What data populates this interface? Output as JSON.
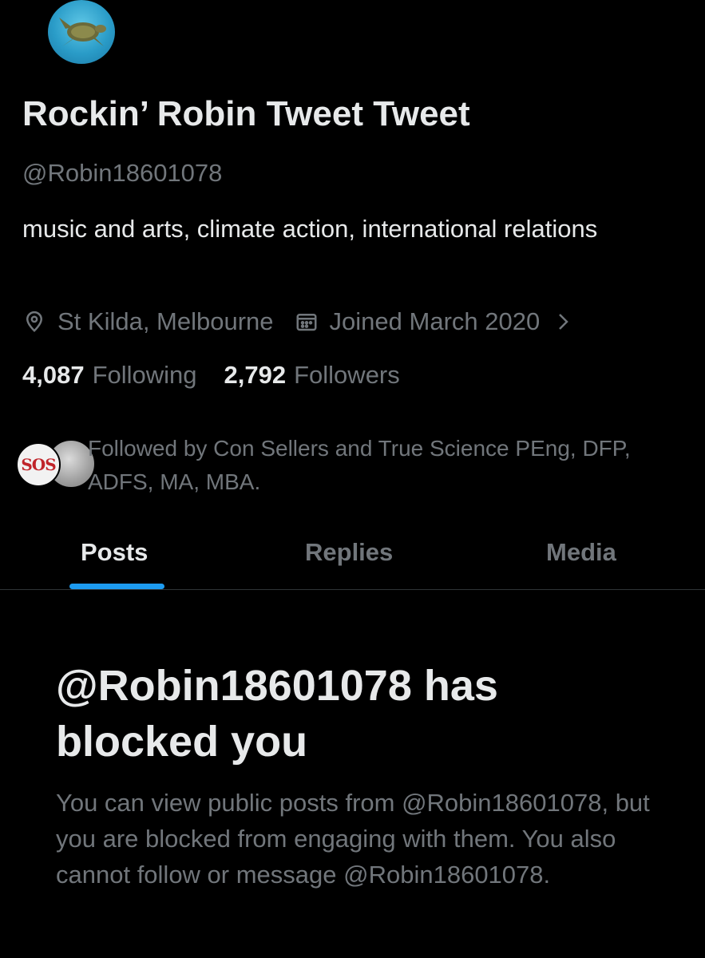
{
  "profile": {
    "display_name": "Rockin’ Robin Tweet Tweet",
    "handle": "@Robin18601078",
    "bio": "music and arts, climate action, international relations",
    "location": "St Kilda, Melbourne",
    "joined": "Joined March 2020",
    "following_count": "4,087",
    "following_label": "Following",
    "followers_count": "2,792",
    "followers_label": "Followers",
    "followed_by": "Followed by Con Sellers and True Science PEng, DFP, ADFS, MA, MBA.",
    "followed_by_avatar_text": "SOS"
  },
  "tabs": [
    {
      "label": "Posts",
      "active": true
    },
    {
      "label": "Replies",
      "active": false
    },
    {
      "label": "Media",
      "active": false
    }
  ],
  "blocked": {
    "title": "@Robin18601078 has blocked you",
    "body": "You can view public posts from @Robin18601078, but you are blocked from engaging with them. You also cannot follow or message @Robin18601078."
  },
  "colors": {
    "background": "#000000",
    "primary_text": "#e7e9ea",
    "secondary_text": "#71767b",
    "accent": "#1d9bf0",
    "divider": "#2f3336"
  },
  "icons": {
    "location": "location-pin-icon",
    "joined": "calendar-icon",
    "more": "chevron-right-icon"
  }
}
